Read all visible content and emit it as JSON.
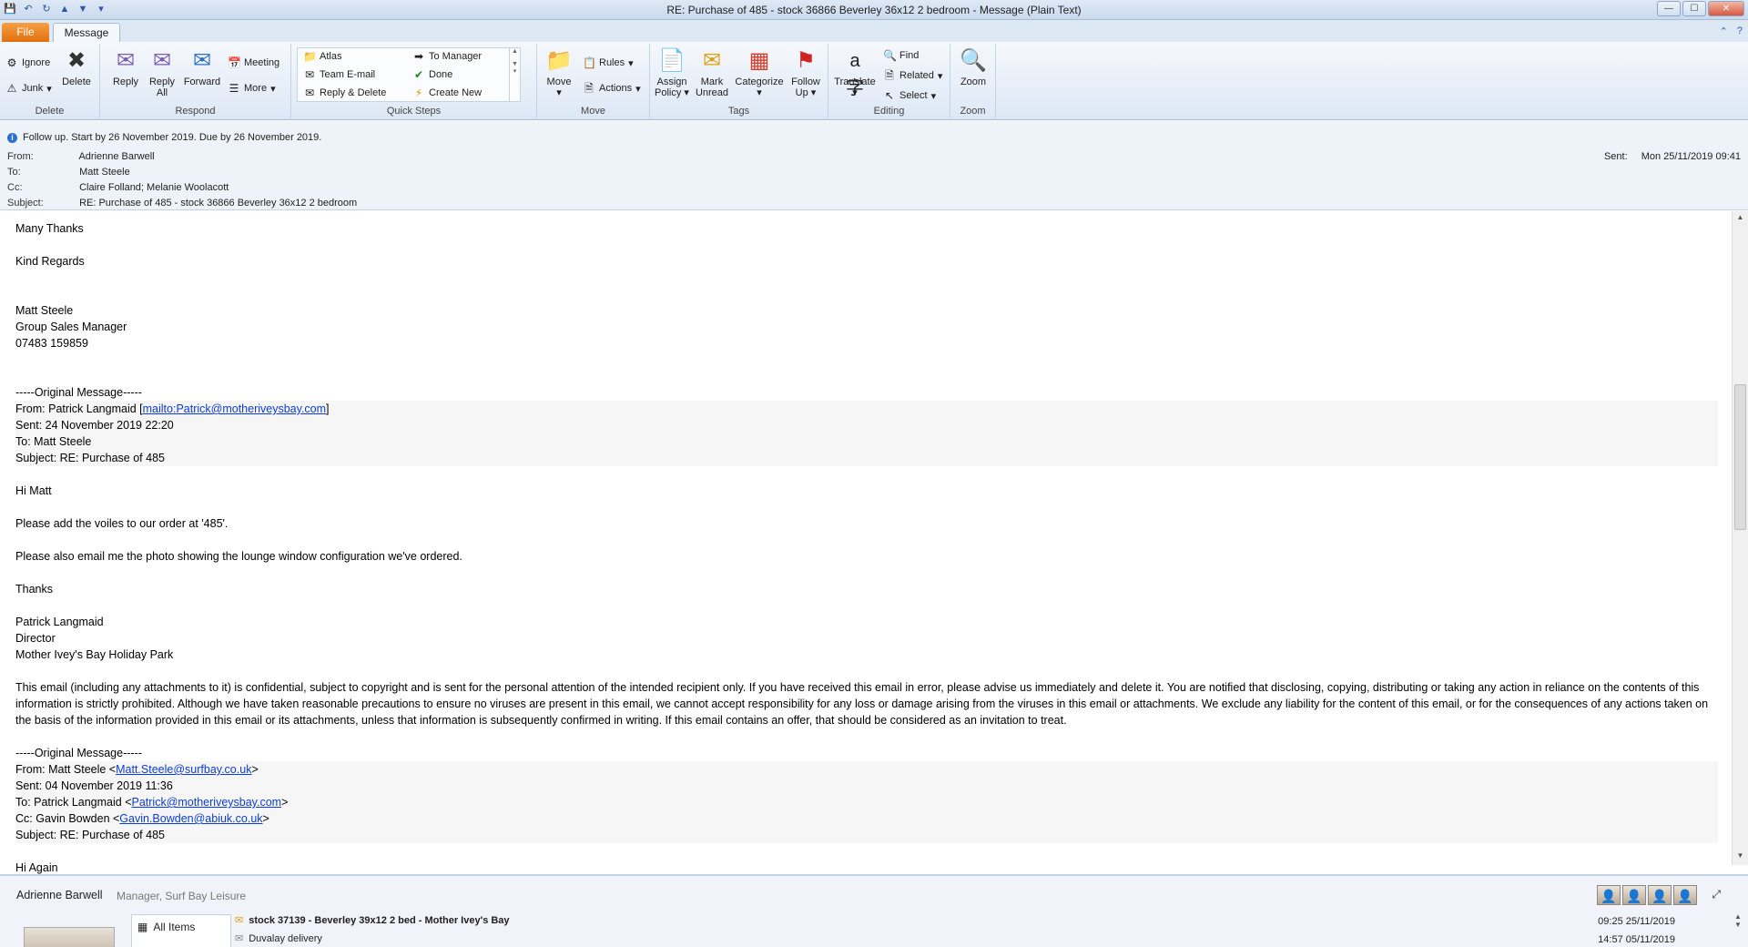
{
  "window": {
    "title": "RE: Purchase of 485 - stock 36866 Beverley 36x12 2 bedroom  -  Message (Plain Text)",
    "qat_icons": [
      "save-icon",
      "undo-icon",
      "redo-icon",
      "up-icon",
      "down-icon",
      "customize-icon"
    ]
  },
  "tabs": {
    "file": "File",
    "message": "Message"
  },
  "ribbon": {
    "delete": {
      "label": "Delete",
      "ignore": "Ignore",
      "junk": "Junk",
      "delete": "Delete"
    },
    "respond": {
      "label": "Respond",
      "reply": "Reply",
      "reply_all_1": "Reply",
      "reply_all_2": "All",
      "forward": "Forward",
      "meeting": "Meeting",
      "more": "More"
    },
    "quick_steps": {
      "label": "Quick Steps",
      "items": [
        "Atlas",
        "Team E-mail",
        "Reply & Delete",
        "To Manager",
        "Done",
        "Create New"
      ]
    },
    "move": {
      "label": "Move",
      "move": "Move",
      "rules": "Rules",
      "actions": "Actions"
    },
    "tags": {
      "label": "Tags",
      "assign_1": "Assign",
      "assign_2": "Policy",
      "mark_1": "Mark",
      "mark_2": "Unread",
      "categorize": "Categorize",
      "follow_1": "Follow",
      "follow_2": "Up"
    },
    "editing": {
      "label": "Editing",
      "translate": "Translate",
      "find": "Find",
      "related": "Related",
      "select": "Select"
    },
    "zoom": {
      "label": "Zoom",
      "zoom": "Zoom"
    }
  },
  "header": {
    "followup": "Follow up.  Start by 26 November 2019.  Due by 26 November 2019.",
    "from_label": "From:",
    "from": "Adrienne Barwell",
    "to_label": "To:",
    "to": "Matt Steele",
    "cc_label": "Cc:",
    "cc": "Claire Folland; Melanie Woolacott",
    "subject_label": "Subject:",
    "subject": "RE: Purchase of 485 - stock 36866 Beverley 36x12 2 bedroom",
    "sent_label": "Sent:",
    "sent": "Mon 25/11/2019 09:41"
  },
  "body": {
    "l1": "Many Thanks",
    "l2": "Kind Regards",
    "sig_name": "Matt Steele",
    "sig_title": "Group Sales Manager",
    "sig_phone": "07483 159859",
    "orig1": "-----Original Message-----",
    "o1_from_pre": "From: Patrick Langmaid [",
    "o1_from_link": "mailto:Patrick@motheriveysbay.com",
    "o1_from_post": "]",
    "o1_sent": "Sent: 24 November 2019 22:20",
    "o1_to": "To: Matt Steele",
    "o1_subject": "Subject: RE: Purchase of 485",
    "hi": "Hi Matt",
    "p1": "Please add the voiles to our order at '485'.",
    "p2": "Please also email me the photo showing the lounge window configuration we've ordered.",
    "thanks": "Thanks",
    "pl_name": "Patrick Langmaid",
    "pl_title": "Director",
    "pl_company": "Mother Ivey's Bay Holiday Park",
    "disclaimer": "This email (including any attachments to it) is confidential, subject to copyright and is sent for the personal attention of the intended recipient only. If you have received this email in error, please advise us immediately and delete it. You are notified that disclosing, copying, distributing or taking any action in reliance on the contents of this information is strictly prohibited. Although we have taken reasonable precautions to ensure no viruses are present in this email, we cannot accept responsibility for any loss or damage arising from the viruses in this email or attachments. We exclude any liability for the content of this email, or for the consequences of any actions taken on the basis of the information provided in this email or its attachments, unless that information is subsequently confirmed in writing. If this email contains an offer, that should be considered as an invitation to treat.",
    "orig2": "-----Original Message-----",
    "o2_from_pre": "From: Matt Steele <",
    "o2_from_link": "Matt.Steele@surfbay.co.uk",
    "o2_from_post": ">",
    "o2_sent": "Sent: 04 November 2019 11:36",
    "o2_to_pre": "To: Patrick Langmaid <",
    "o2_to_link": "Patrick@motheriveysbay.com",
    "o2_to_post": ">",
    "o2_cc_pre": "Cc: Gavin Bowden <",
    "o2_cc_link": "Gavin.Bowden@abiuk.co.uk",
    "o2_cc_post": ">",
    "o2_subject": "Subject: RE: Purchase of 485",
    "cut": "Hi Again"
  },
  "people": {
    "name": "Adrienne Barwell",
    "role": "Manager, Surf Bay Leisure",
    "all_items": "All Items",
    "rows": [
      {
        "subject": "stock 37139 - Beverley 39x12 2 bed - Mother Ivey's Bay",
        "date": "09:25  25/11/2019"
      },
      {
        "subject": "Duvalay delivery",
        "date": "14:57  05/11/2019"
      }
    ]
  }
}
